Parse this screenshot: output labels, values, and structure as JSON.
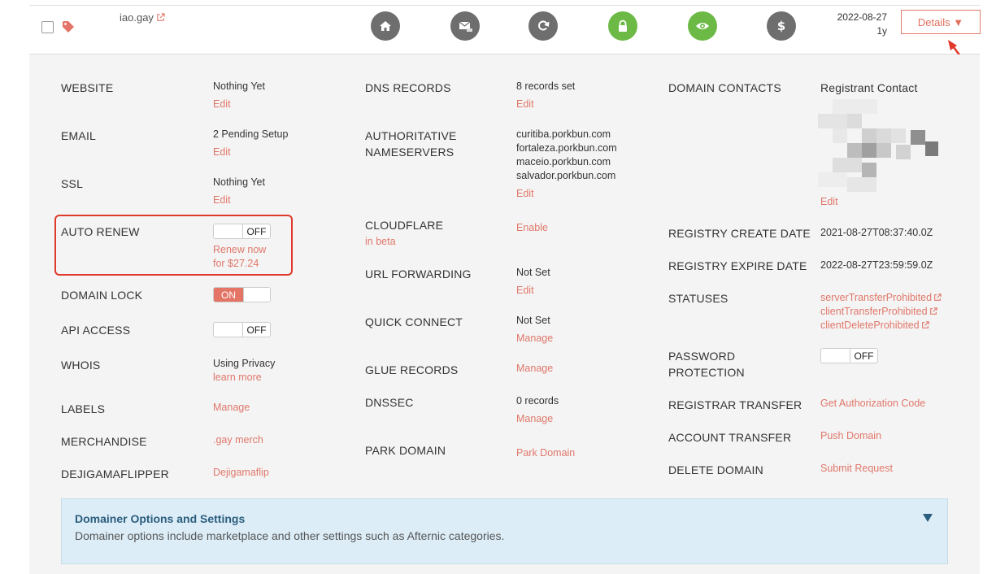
{
  "domain_row": {
    "name": "iao.gay",
    "date": "2022-08-27",
    "term": "1y",
    "details_label": "Details ▼",
    "action_icons": [
      "home-icon",
      "email-forward-icon",
      "refresh-icon",
      "lock-icon",
      "eye-icon",
      "dollar-icon"
    ]
  },
  "col1": {
    "website": {
      "label": "WEBSITE",
      "value": "Nothing Yet",
      "link": "Edit"
    },
    "email": {
      "label": "EMAIL",
      "value": "2 Pending Setup",
      "link": "Edit"
    },
    "ssl": {
      "label": "SSL",
      "value": "Nothing Yet",
      "link": "Edit"
    },
    "auto_renew": {
      "label": "AUTO RENEW",
      "toggle": "OFF",
      "link1": "Renew now",
      "link2": "for $27.24"
    },
    "domain_lock": {
      "label": "DOMAIN LOCK",
      "toggle": "ON"
    },
    "api_access": {
      "label": "API ACCESS",
      "toggle": "OFF"
    },
    "whois": {
      "label": "WHOIS",
      "value": "Using Privacy",
      "link": "learn more"
    },
    "labels": {
      "label": "LABELS",
      "link": "Manage"
    },
    "merchandise": {
      "label": "MERCHANDISE",
      "link": ".gay merch"
    },
    "dejigamaflipper": {
      "label": "DEJIGAMAFLIPPER",
      "link": "Dejigamaflip"
    }
  },
  "col2": {
    "dns": {
      "label": "DNS RECORDS",
      "value": "8 records set",
      "link": "Edit"
    },
    "nameservers": {
      "label1": "AUTHORITATIVE",
      "label2": "NAMESERVERS",
      "values": [
        "curitiba.porkbun.com",
        "fortaleza.porkbun.com",
        "maceio.porkbun.com",
        "salvador.porkbun.com"
      ],
      "link": "Edit"
    },
    "cloudflare": {
      "label": "CLOUDFLARE",
      "sub": "in beta",
      "link": "Enable"
    },
    "url_forwarding": {
      "label": "URL FORWARDING",
      "value": "Not Set",
      "link": "Edit"
    },
    "quick_connect": {
      "label": "QUICK CONNECT",
      "value": "Not Set",
      "link": "Manage"
    },
    "glue": {
      "label": "GLUE RECORDS",
      "link": "Manage"
    },
    "dnssec": {
      "label": "DNSSEC",
      "value": "0 records",
      "link": "Manage"
    },
    "park": {
      "label": "PARK DOMAIN",
      "link": "Park Domain"
    }
  },
  "col3": {
    "contacts": {
      "label": "DOMAIN CONTACTS",
      "value": "Registrant Contact",
      "link": "Edit"
    },
    "create_date": {
      "label": "REGISTRY CREATE DATE",
      "value": "2021-08-27T08:37:40.0Z"
    },
    "expire_date": {
      "label": "REGISTRY EXPIRE DATE",
      "value": "2022-08-27T23:59:59.0Z"
    },
    "statuses": {
      "label": "STATUSES",
      "values": [
        "serverTransferProhibited",
        "clientTransferProhibited",
        "clientDeleteProhibited"
      ]
    },
    "password": {
      "label1": "PASSWORD",
      "label2": "PROTECTION",
      "toggle": "OFF"
    },
    "registrar_transfer": {
      "label": "REGISTRAR TRANSFER",
      "link": "Get Authorization Code"
    },
    "account_transfer": {
      "label": "ACCOUNT TRANSFER",
      "link": "Push Domain"
    },
    "delete": {
      "label": "DELETE DOMAIN",
      "link": "Submit Request"
    }
  },
  "domainer": {
    "title": "Domainer Options and Settings",
    "desc": "Domainer options include marketplace and other settings such as Afternic categories."
  },
  "colors": {
    "accent": "#e0776a",
    "green": "#6cba45",
    "grey_icon": "#6e6e6e",
    "info_bg": "#dcedf7",
    "annotation_red": "#e0392b"
  }
}
